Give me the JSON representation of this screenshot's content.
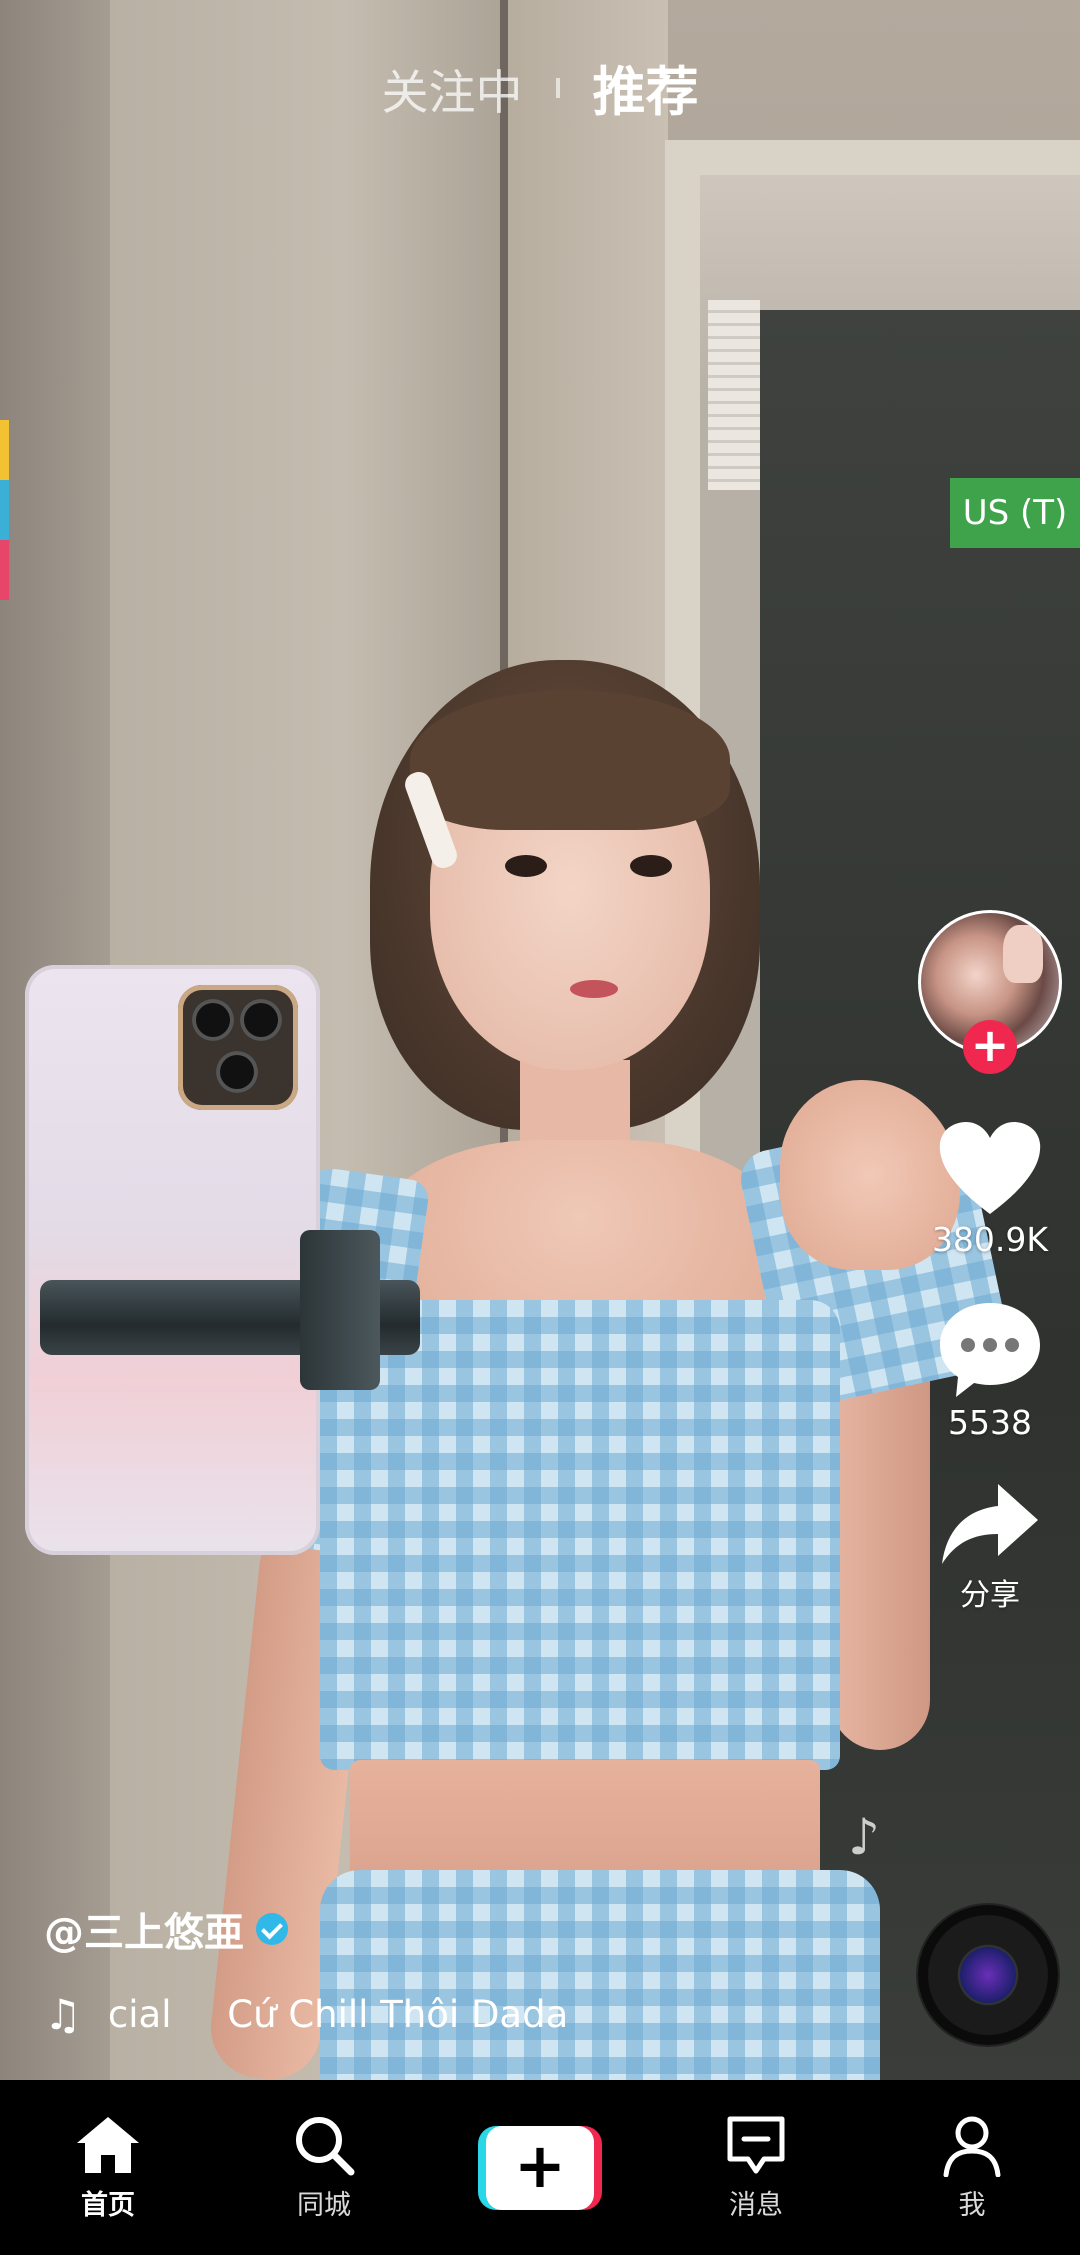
{
  "top_tabs": {
    "following": "关注中",
    "recommend": "推荐"
  },
  "region_badge": "US (T)",
  "actions": {
    "likes": "380.9K",
    "comments": "5538",
    "share": "分享"
  },
  "caption": {
    "username": "@三上悠亜",
    "music_prev": "icial",
    "music_title": "Cứ Chill Thôi Dada"
  },
  "bottom_nav": {
    "home": "首页",
    "nearby": "同城",
    "create": "+",
    "messages": "消息",
    "me": "我"
  },
  "colors": {
    "accent_red": "#f0284f",
    "accent_cyan": "#29d7e6",
    "badge_green": "#3ea34a",
    "verified_blue": "#2fb8e8"
  },
  "icons": {
    "like": "heart-icon",
    "comment": "comment-bubble-icon",
    "share": "share-arrow-icon",
    "home": "home-icon",
    "nearby": "search-icon",
    "messages": "message-icon",
    "me": "person-icon",
    "music": "music-note-icon"
  }
}
